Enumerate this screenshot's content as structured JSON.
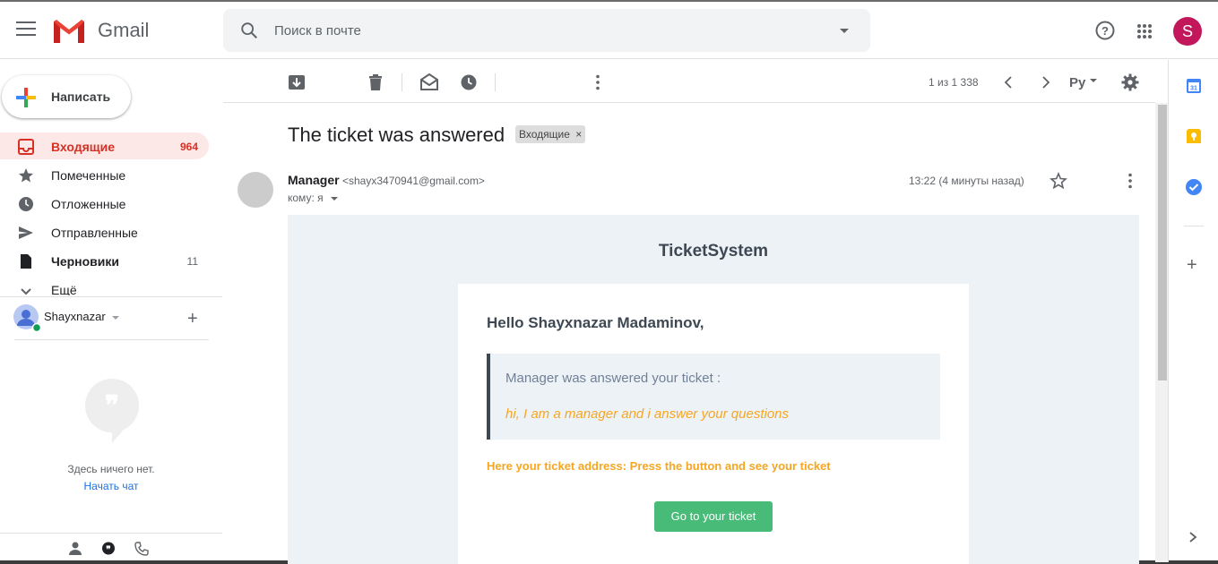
{
  "header": {
    "app_name": "Gmail",
    "search_placeholder": "Поиск в почте",
    "avatar_letter": "S"
  },
  "sidebar": {
    "compose_label": "Написать",
    "items": [
      {
        "label": "Входящие",
        "count": "964",
        "icon": "inbox-icon",
        "active": true
      },
      {
        "label": "Помеченные",
        "count": "",
        "icon": "star-icon"
      },
      {
        "label": "Отложенные",
        "count": "",
        "icon": "clock-icon"
      },
      {
        "label": "Отправленные",
        "count": "",
        "icon": "send-icon"
      },
      {
        "label": "Черновики",
        "count": "11",
        "icon": "draft-icon"
      },
      {
        "label": "Ещё",
        "count": "",
        "icon": "chevron-down-icon"
      }
    ],
    "hangouts_user": "Shayxnazar",
    "empty_text": "Здесь ничего нет.",
    "start_chat": "Начать чат"
  },
  "toolbar": {
    "pagination": "1 из 1 338",
    "input_tool": "Ру"
  },
  "message": {
    "subject": "The ticket was answered",
    "label_chip": "Входящие",
    "sender_name": "Manager",
    "sender_email": "<shayx3470941@gmail.com>",
    "to": "кому: я",
    "time": "13:22 (4 минуты назад)"
  },
  "email": {
    "brand": "TicketSystem",
    "greeting": "Hello Shayxnazar Madaminov,",
    "quote_line": "Manager was answered your ticket :",
    "quote_message": "hi, I am a manager and i answer your questions",
    "address_line": "Here your ticket address: Press the button and see your ticket",
    "button_label": "Go to your ticket"
  },
  "colors": {
    "accent_red": "#d93025",
    "button_green": "#48bb78",
    "orange_text": "#f5a623"
  }
}
